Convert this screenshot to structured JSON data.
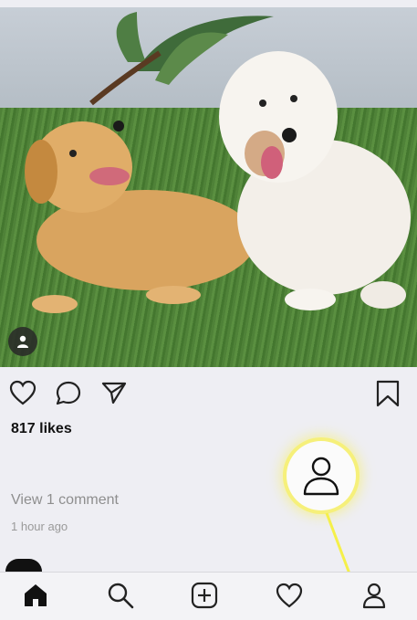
{
  "post": {
    "likes_text": "817 likes",
    "view_comments_text": "View 1 comment",
    "timestamp_text": "1 hour ago"
  },
  "icons": {
    "like": "heart-icon",
    "comment": "comment-icon",
    "share": "send-icon",
    "save": "bookmark-icon",
    "tag": "user-tag-icon",
    "profile_highlight": "profile-icon"
  },
  "bottom_nav": {
    "items": [
      {
        "name": "home",
        "icon": "home-icon"
      },
      {
        "name": "search",
        "icon": "search-icon"
      },
      {
        "name": "new-post",
        "icon": "plus-square-icon"
      },
      {
        "name": "activity",
        "icon": "heart-icon"
      },
      {
        "name": "profile",
        "icon": "profile-icon"
      }
    ]
  },
  "colors": {
    "highlight": "#f6f07a",
    "pointer": "#f5f04a",
    "muted_text": "#8e8e8e"
  }
}
